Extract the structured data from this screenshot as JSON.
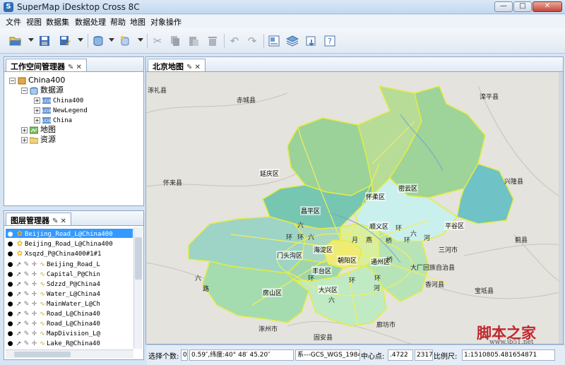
{
  "window": {
    "title": "SuperMap iDesktop Cross 8C",
    "controls": [
      "—",
      "□",
      "✕"
    ]
  },
  "menu": [
    "文件",
    "视图",
    "数据集",
    "数据处理",
    "帮助",
    "地图",
    "对象操作"
  ],
  "toolbar": {
    "icons": [
      "open-icon",
      "save-icon",
      "save-as-icon",
      "database-icon",
      "new-datasource-icon",
      "cut-icon",
      "copy-icon",
      "paste-icon",
      "delete-icon",
      "undo-icon",
      "redo-icon",
      "layout-icon",
      "layers-icon",
      "export-icon",
      "help-icon"
    ]
  },
  "workspace_panel": {
    "title": "工作空间管理器",
    "pin": "✎ ✕",
    "tree": {
      "root": "China400",
      "datasources_label": "数据源",
      "datasources": [
        "China400",
        "NewLegend",
        "China"
      ],
      "maps_label": "地图",
      "resources_label": "资源"
    }
  },
  "layer_panel": {
    "title": "图层管理器",
    "pin": "✎ ✕",
    "layers": [
      "Beijing_Road_L@China400",
      "Beijing_Road_L@China400",
      "Xsqzd_P@China400#1#1",
      "Beijing_Road_L",
      "Capital_P@Chin",
      "Sdzzd_P@China4",
      "Water_L@China4",
      "MainWater_L@Ch",
      "Road_L@China40",
      "Road_L@China40",
      "MapDivision_L@",
      "Lake_R@China40"
    ]
  },
  "map_tab": {
    "title": "北京地图",
    "pin": "✎ ✕"
  },
  "map_labels": {
    "outside": [
      "涿礼县",
      "赤城县",
      "滦平县",
      "怀来县",
      "兴隆县",
      "蓟县",
      "三河市",
      "大厂回族自治县",
      "香河县",
      "宝坻县",
      "涿州市",
      "固安县",
      "廊坊市"
    ],
    "districts": [
      "延庆区",
      "怀柔区",
      "密云区",
      "昌平区",
      "平谷区",
      "顺义区",
      "门头沟区",
      "海淀区",
      "朝阳区",
      "通州区",
      "丰台区",
      "房山区",
      "大兴区"
    ],
    "road_text": [
      "六",
      "环",
      "环",
      "六",
      "环",
      "六",
      "河",
      "桥",
      "环",
      "环",
      "路",
      "月",
      "燕",
      "桥",
      "河",
      "环",
      "环",
      "六",
      "六"
    ]
  },
  "status": {
    "select_label": "选择个数:",
    "select_value": "0",
    "coords": "0.59″,纬度:40° 48′ 45.20″",
    "crs": "系---GCS_WGS_1984",
    "center_label": "中心点:",
    "center_x": ".4722",
    "center_y": "2317",
    "scale_label": "比例尺:",
    "scale_value": "1:1510805.481654871"
  },
  "watermark": {
    "title": "脚本之家",
    "url": "www.jb51.net"
  },
  "colors": {
    "map_background": "#e4e3de",
    "selection": "#3399ff",
    "region_border": "#e9ee4b"
  }
}
